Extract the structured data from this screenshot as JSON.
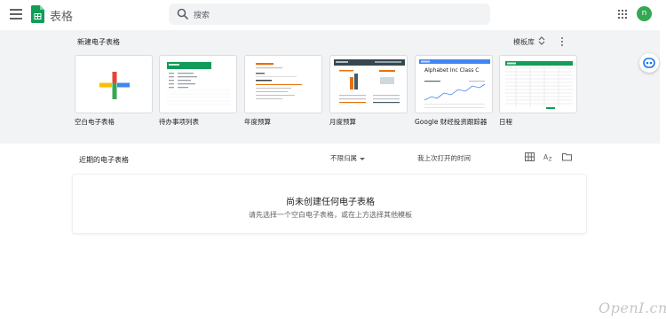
{
  "app": {
    "title": "表格",
    "avatar_letter": "n",
    "avatar_color": "#33a852"
  },
  "search": {
    "placeholder": "搜索"
  },
  "gallery": {
    "title": "新建电子表格",
    "template_gallery_label": "模板库",
    "templates": [
      {
        "label": "空白电子表格",
        "kind": "blank"
      },
      {
        "label": "待办事项列表",
        "kind": "todo"
      },
      {
        "label": "年度预算",
        "kind": "annual"
      },
      {
        "label": "月度预算",
        "kind": "monthly"
      },
      {
        "label": "Google 财经投资跟踪器",
        "kind": "finance"
      },
      {
        "label": "日程",
        "kind": "schedule"
      }
    ]
  },
  "recent": {
    "title": "近期的电子表格",
    "owner_filter": "不限归属",
    "sort_label": "我上次打开的时间",
    "empty_title": "尚未创建任何电子表格",
    "empty_subtitle": "请先选择一个空白电子表格，或在上方选择其他模板"
  },
  "finance_thumb_title": "Alphabet Inc Class C",
  "watermark": "OpenI.cn",
  "colors": {
    "accent_green": "#0f9d58",
    "gallery_bg": "#f1f3f4"
  }
}
